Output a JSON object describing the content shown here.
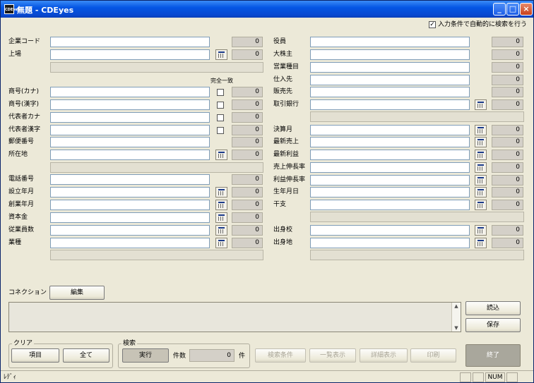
{
  "window": {
    "title": "無題 - CDEyes",
    "app_icon_text": "CDEyes"
  },
  "auto_search": {
    "checked": true,
    "label": "入力条件で自動的に検索を行う"
  },
  "left": {
    "company_code": {
      "label": "企業コード",
      "count": "0"
    },
    "listing": {
      "label": "上場",
      "count": "0"
    },
    "exact_match_header": "完全一致",
    "trade_name_kana": {
      "label": "商号(カナ)",
      "count": "0"
    },
    "trade_name_kanji": {
      "label": "商号(漢字)",
      "count": "0"
    },
    "rep_kana": {
      "label": "代表者カナ",
      "count": "0"
    },
    "rep_kanji": {
      "label": "代表者漢字",
      "count": "0"
    },
    "postal_code": {
      "label": "郵便番号",
      "count": "0"
    },
    "address": {
      "label": "所在地",
      "count": "0"
    },
    "phone": {
      "label": "電話番号",
      "count": "0"
    },
    "established": {
      "label": "設立年月",
      "count": "0"
    },
    "founded": {
      "label": "創業年月",
      "count": "0"
    },
    "capital": {
      "label": "資本金",
      "count": "0"
    },
    "employees": {
      "label": "従業員数",
      "count": "0"
    },
    "industry": {
      "label": "業種",
      "count": "0"
    }
  },
  "right": {
    "officers": {
      "label": "役員",
      "count": "0"
    },
    "shareholders": {
      "label": "大株主",
      "count": "0"
    },
    "business": {
      "label": "営業種目",
      "count": "0"
    },
    "suppliers": {
      "label": "仕入先",
      "count": "0"
    },
    "customers": {
      "label": "販売先",
      "count": "0"
    },
    "banks": {
      "label": "取引銀行",
      "count": "0"
    },
    "fiscal_month": {
      "label": "決算月",
      "count": "0"
    },
    "latest_sales": {
      "label": "最新売上",
      "count": "0"
    },
    "latest_profit": {
      "label": "最新利益",
      "count": "0"
    },
    "sales_growth": {
      "label": "売上伸長率",
      "count": "0"
    },
    "profit_growth": {
      "label": "利益伸長率",
      "count": "0"
    },
    "birth_date": {
      "label": "生年月日",
      "count": "0"
    },
    "zodiac": {
      "label": "干支",
      "count": "0"
    },
    "alma_mater": {
      "label": "出身校",
      "count": "0"
    },
    "birthplace": {
      "label": "出身地",
      "count": "0"
    }
  },
  "connection": {
    "label": "コネクション",
    "edit_button": "編集",
    "load_button": "読込",
    "save_button": "保存"
  },
  "clear_group": {
    "title": "クリア",
    "items_button": "項目",
    "all_button": "全て"
  },
  "search_group": {
    "title": "検索",
    "run_button": "実行",
    "count_label": "件数",
    "count_value": "0",
    "count_unit": "件"
  },
  "actions": {
    "search_conditions": "検索条件",
    "list_view": "一覧表示",
    "detail_view": "詳細表示",
    "print": "印刷",
    "exit": "終了"
  },
  "status": {
    "text": "ﾚﾃﾞｨ",
    "num": "NUM"
  }
}
